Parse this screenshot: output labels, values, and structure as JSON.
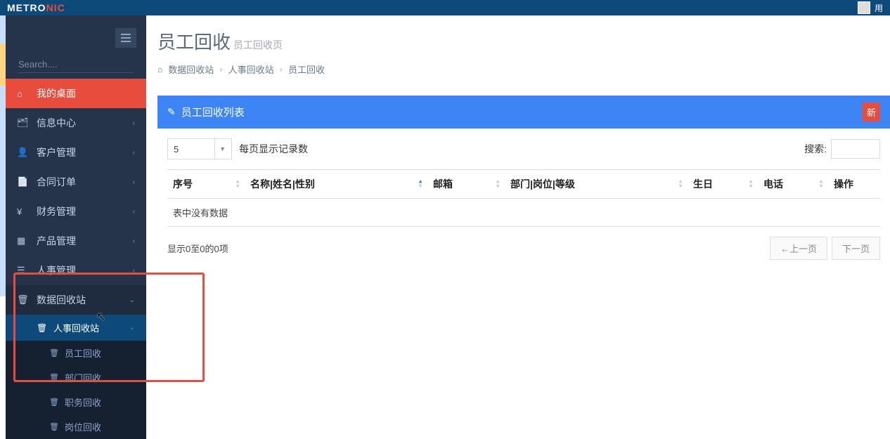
{
  "topbar": {
    "logo_part1": "METRO",
    "logo_part2": "NIC",
    "username": "用"
  },
  "sidebar": {
    "search_placeholder": "Search....",
    "items": [
      {
        "icon": "⌂",
        "label": "我的桌面"
      },
      {
        "icon": "🗂",
        "label": "信息中心"
      },
      {
        "icon": "👤",
        "label": "客户管理"
      },
      {
        "icon": "📄",
        "label": "合同订单"
      },
      {
        "icon": "¥",
        "label": "财务管理"
      },
      {
        "icon": "▦",
        "label": "产品管理"
      },
      {
        "icon": "☰",
        "label": "人事管理"
      },
      {
        "icon": "🗑",
        "label": "数据回收站"
      }
    ],
    "sub_recycle": {
      "label": "人事回收站",
      "icon": "🗑",
      "children": [
        {
          "icon": "🗑",
          "label": "员工回收"
        },
        {
          "icon": "🗑",
          "label": "部门回收"
        },
        {
          "icon": "🗑",
          "label": "职务回收"
        },
        {
          "icon": "🗑",
          "label": "岗位回收"
        }
      ]
    }
  },
  "header": {
    "title": "员工回收",
    "subtitle": "员工回收页"
  },
  "breadcrumb": {
    "home_icon": "⌂",
    "items": [
      "数据回收站",
      "人事回收站",
      "员工回收"
    ]
  },
  "panel": {
    "icon": "✎",
    "title": "员工回收列表",
    "new_btn": "新"
  },
  "controls": {
    "page_size": "5",
    "records_label": "每页显示记录数",
    "search_label": "搜索:"
  },
  "table": {
    "columns": [
      "序号",
      "名称|姓名|性别",
      "邮箱",
      "部门|岗位|等级",
      "生日",
      "电话",
      "操作"
    ],
    "empty": "表中没有数据"
  },
  "footer": {
    "info": "显示0至0的0项",
    "prev": "←上一页",
    "next": "下一页"
  }
}
